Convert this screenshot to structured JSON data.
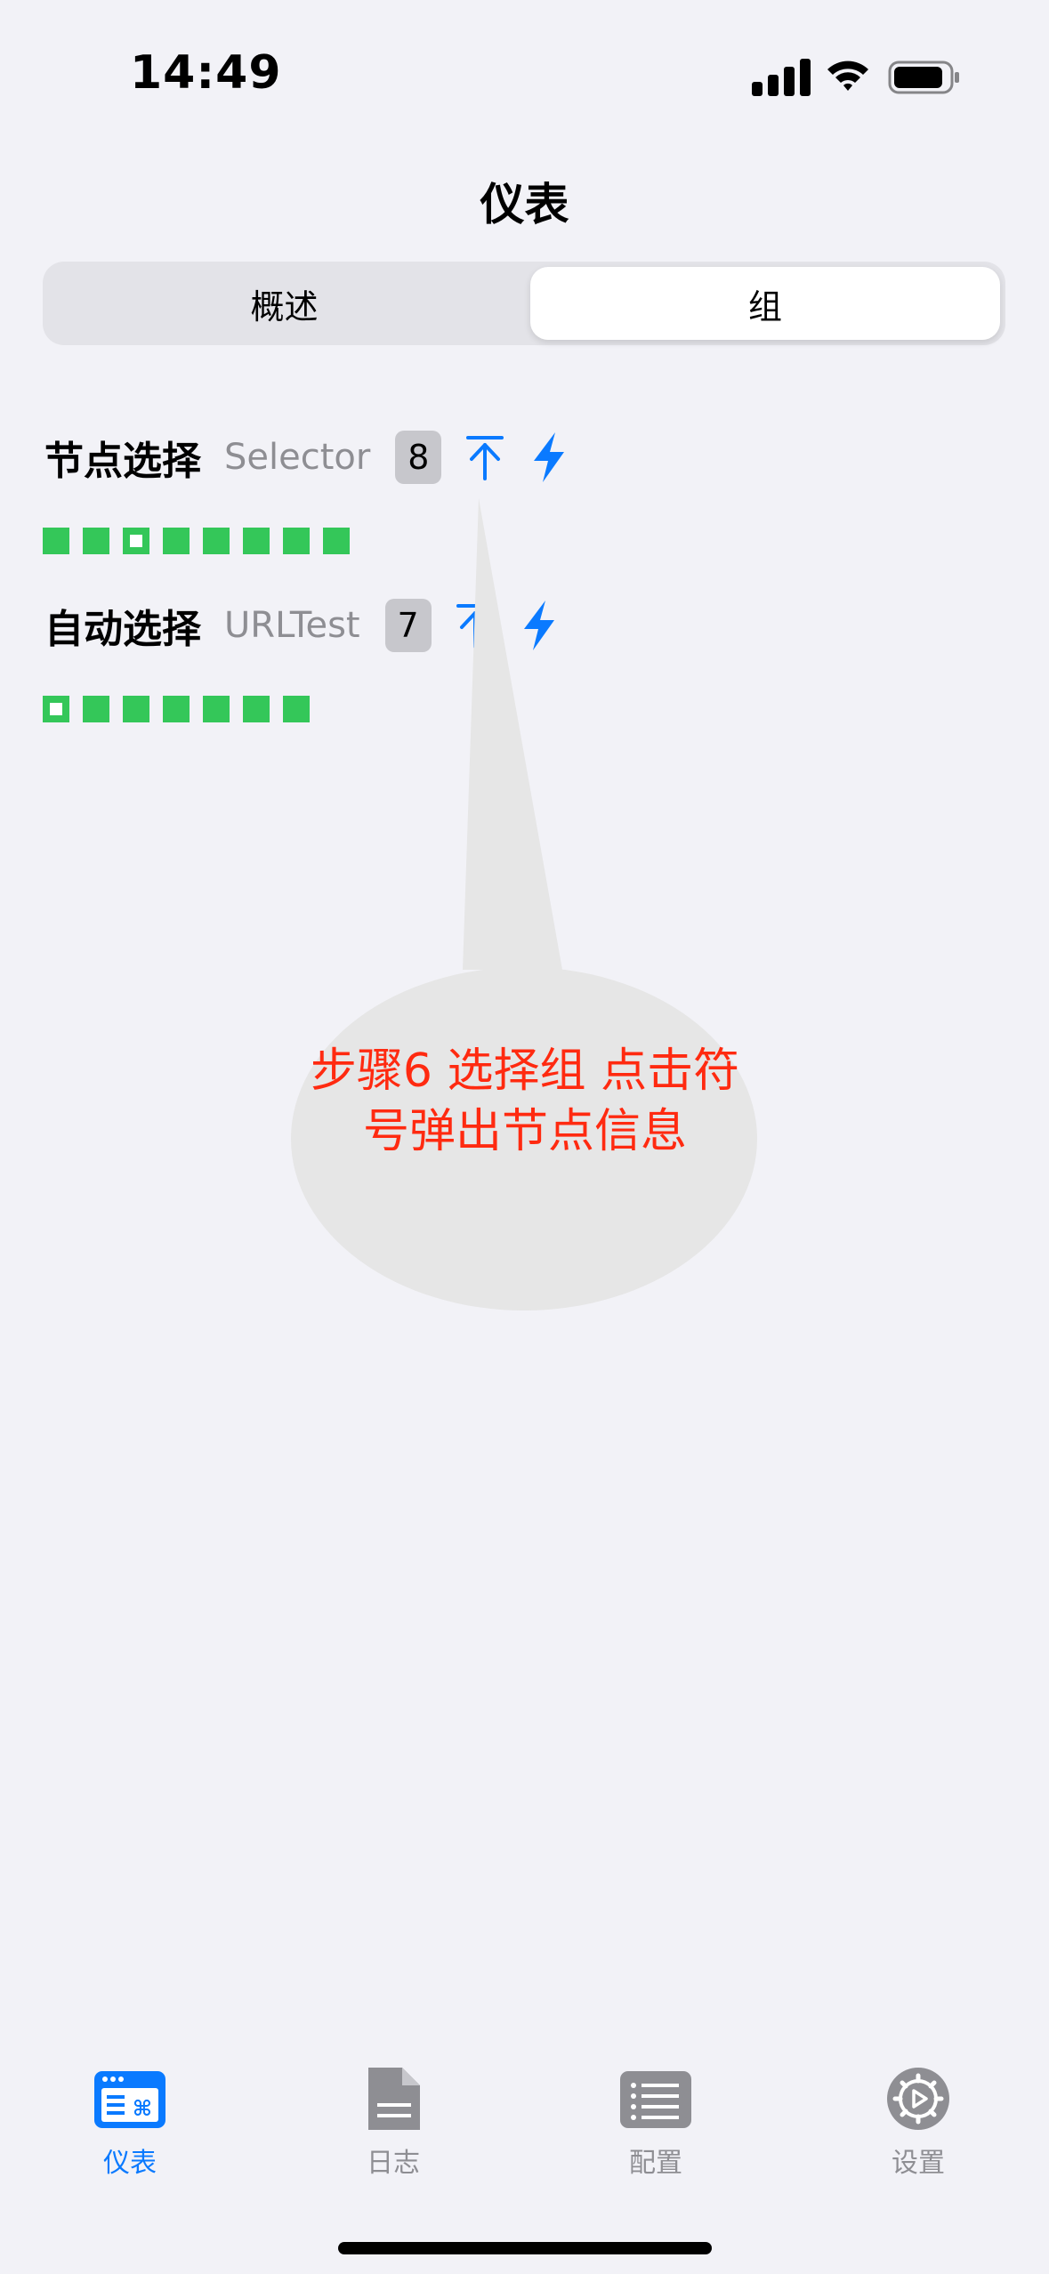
{
  "status_bar": {
    "time": "14:49"
  },
  "nav": {
    "title": "仪表"
  },
  "segmented": {
    "items": [
      "概述",
      "组"
    ],
    "selected": "组"
  },
  "groups": [
    {
      "name": "节点选择",
      "type": "Selector",
      "count": "8",
      "node_count": 8,
      "selected_index": 2
    },
    {
      "name": "自动选择",
      "type": "URLTest",
      "count": "7",
      "node_count": 7,
      "selected_index": 0
    }
  ],
  "annotation": {
    "text": "步骤6 选择组 点击符号弹出节点信息"
  },
  "tab_bar": {
    "items": [
      {
        "label": "仪表",
        "icon": "dashboard-icon",
        "active": true
      },
      {
        "label": "日志",
        "icon": "document-icon",
        "active": false
      },
      {
        "label": "配置",
        "icon": "list-icon",
        "active": false
      },
      {
        "label": "设置",
        "icon": "gear-icon",
        "active": false
      }
    ]
  },
  "colors": {
    "accent": "#0A7AFF",
    "node_green": "#34C759",
    "inactive_tab": "#8E8E93",
    "annotation_text": "#FF2A10",
    "background": "#F2F2F7"
  }
}
